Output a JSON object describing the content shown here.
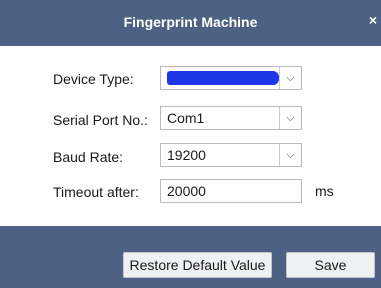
{
  "dialog": {
    "title": "Fingerprint Machine",
    "close_glyph": "×"
  },
  "form": {
    "device_type": {
      "label": "Device Type:",
      "value": "",
      "redacted": true
    },
    "serial_port": {
      "label": "Serial Port No.:",
      "value": "Com1"
    },
    "baud_rate": {
      "label": "Baud Rate:",
      "value": "19200"
    },
    "timeout": {
      "label": "Timeout after:",
      "value": "20000",
      "unit": "ms"
    }
  },
  "buttons": {
    "restore_label": "Restore Default Value",
    "save_label": "Save"
  },
  "icons": {
    "dropdown": "chevron-down-icon",
    "close": "close-icon"
  },
  "colors": {
    "titlebar": "#4d6282",
    "footer": "#4d6282",
    "redaction": "#1f36e8"
  }
}
